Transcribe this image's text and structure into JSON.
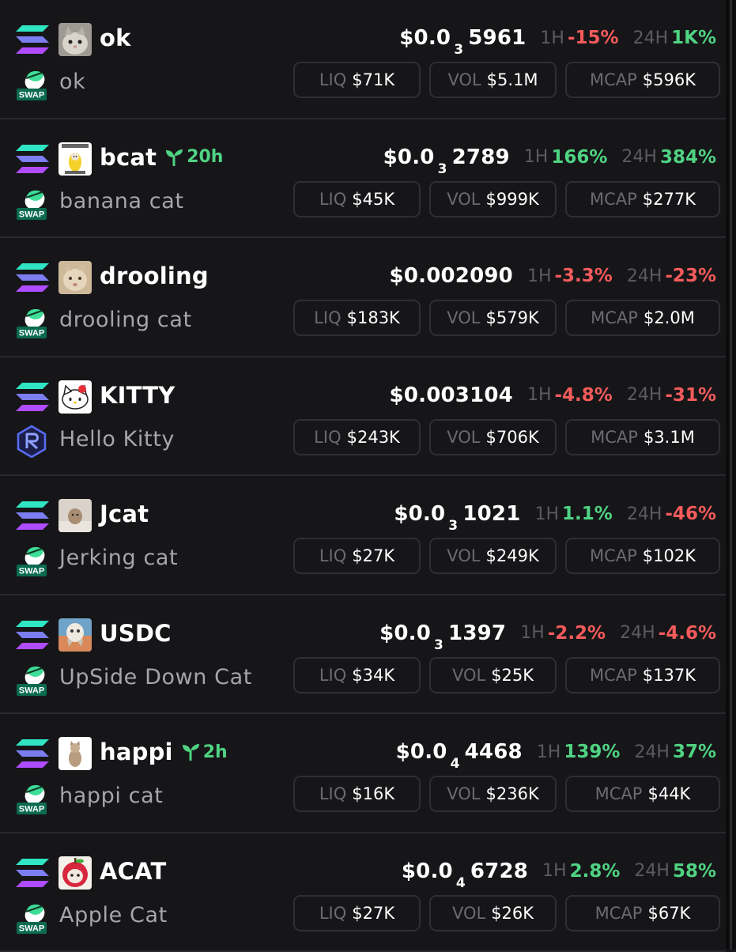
{
  "labels": {
    "h1": "1H",
    "h24": "24H",
    "liq": "LIQ",
    "vol": "VOL",
    "mcap": "MCAP",
    "swap": "SWAP"
  },
  "colors": {
    "background": "#161619",
    "positive": "#4fd382",
    "negative": "#f45b5b",
    "muted_label": "#5a5a62",
    "name_text": "#a5a5ab",
    "border": "#2e2e33"
  },
  "tokens": [
    {
      "symbol": "ok",
      "name": "ok",
      "age": "",
      "price_prefix": "$0.0",
      "zero_count": "3",
      "price_digits": "5961",
      "h1": "-15%",
      "h1_dir": "down",
      "h24": "1K%",
      "h24_dir": "up",
      "liq": "$71K",
      "vol": "$5.1M",
      "mcap": "$596K",
      "dex_icon": "swap-icon",
      "avatar_icon": "cat-photo-avatar"
    },
    {
      "symbol": "bcat",
      "name": "banana cat",
      "age": "20h",
      "price_prefix": "$0.0",
      "zero_count": "3",
      "price_digits": "2789",
      "h1": "166%",
      "h1_dir": "up",
      "h24": "384%",
      "h24_dir": "up",
      "liq": "$45K",
      "vol": "$999K",
      "mcap": "$277K",
      "dex_icon": "swap-icon",
      "avatar_icon": "banana-cat-avatar"
    },
    {
      "symbol": "drooling",
      "name": "drooling cat",
      "age": "",
      "price_prefix": "$0.002090",
      "zero_count": "",
      "price_digits": "",
      "h1": "-3.3%",
      "h1_dir": "down",
      "h24": "-23%",
      "h24_dir": "down",
      "liq": "$183K",
      "vol": "$579K",
      "mcap": "$2.0M",
      "dex_icon": "swap-icon",
      "avatar_icon": "drooling-cat-avatar"
    },
    {
      "symbol": "KITTY",
      "name": "Hello Kitty",
      "age": "",
      "price_prefix": "$0.003104",
      "zero_count": "",
      "price_digits": "",
      "h1": "-4.8%",
      "h1_dir": "down",
      "h24": "-31%",
      "h24_dir": "down",
      "liq": "$243K",
      "vol": "$706K",
      "mcap": "$3.1M",
      "dex_icon": "raydium-icon",
      "avatar_icon": "hello-kitty-avatar"
    },
    {
      "symbol": "Jcat",
      "name": "Jerking cat",
      "age": "",
      "price_prefix": "$0.0",
      "zero_count": "3",
      "price_digits": "1021",
      "h1": "1.1%",
      "h1_dir": "up",
      "h24": "-46%",
      "h24_dir": "down",
      "liq": "$27K",
      "vol": "$249K",
      "mcap": "$102K",
      "dex_icon": "swap-icon",
      "avatar_icon": "jcat-avatar"
    },
    {
      "symbol": "USDC",
      "name": "UpSide Down Cat",
      "age": "",
      "price_prefix": "$0.0",
      "zero_count": "3",
      "price_digits": "1397",
      "h1": "-2.2%",
      "h1_dir": "down",
      "h24": "-4.6%",
      "h24_dir": "down",
      "liq": "$34K",
      "vol": "$25K",
      "mcap": "$137K",
      "dex_icon": "swap-icon",
      "avatar_icon": "upside-down-cat-avatar"
    },
    {
      "symbol": "happi",
      "name": "happi cat",
      "age": "2h",
      "price_prefix": "$0.0",
      "zero_count": "4",
      "price_digits": "4468",
      "h1": "139%",
      "h1_dir": "up",
      "h24": "37%",
      "h24_dir": "up",
      "liq": "$16K",
      "vol": "$236K",
      "mcap": "$44K",
      "dex_icon": "swap-icon",
      "avatar_icon": "happi-cat-avatar"
    },
    {
      "symbol": "ACAT",
      "name": "Apple Cat",
      "age": "",
      "price_prefix": "$0.0",
      "zero_count": "4",
      "price_digits": "6728",
      "h1": "2.8%",
      "h1_dir": "up",
      "h24": "58%",
      "h24_dir": "up",
      "liq": "$27K",
      "vol": "$26K",
      "mcap": "$67K",
      "dex_icon": "swap-icon",
      "avatar_icon": "apple-cat-avatar"
    }
  ]
}
